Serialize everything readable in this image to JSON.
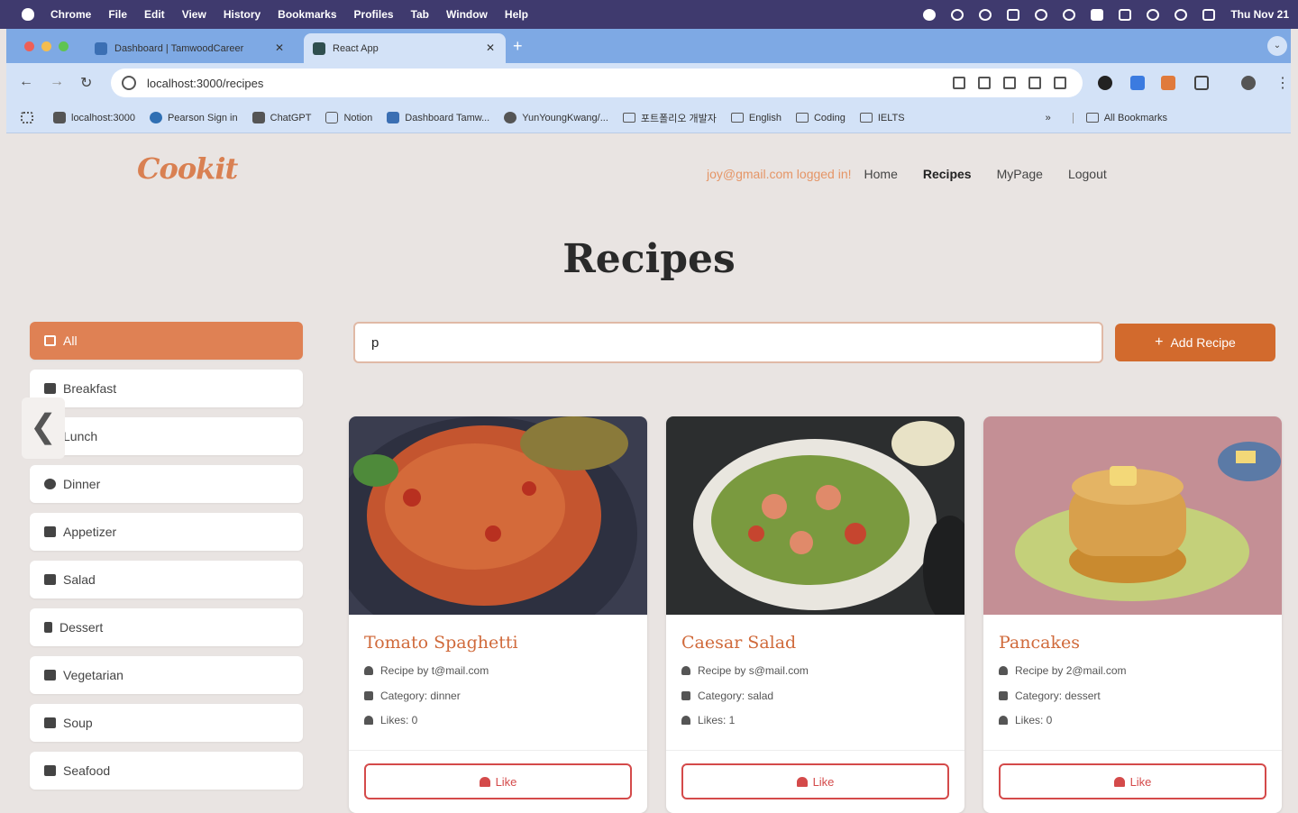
{
  "menubar": {
    "app": "Chrome",
    "items": [
      "File",
      "Edit",
      "View",
      "History",
      "Bookmarks",
      "Profiles",
      "Tab",
      "Window",
      "Help"
    ],
    "clock": "Thu Nov 21"
  },
  "tabs": [
    {
      "title": "Dashboard | TamwoodCareer",
      "active": false
    },
    {
      "title": "React App",
      "active": true
    }
  ],
  "toolbar": {
    "url": "localhost:3000/recipes"
  },
  "bookmarks": [
    {
      "label": "localhost:3000",
      "icon": "page-icon"
    },
    {
      "label": "Pearson Sign in",
      "icon": "page-icon"
    },
    {
      "label": "ChatGPT",
      "icon": "page-icon"
    },
    {
      "label": "Notion",
      "icon": "page-icon"
    },
    {
      "label": "Dashboard  Tamw...",
      "icon": "page-icon"
    },
    {
      "label": "YunYoungKwang/...",
      "icon": "github-icon"
    },
    {
      "label": "포트폴리오 개발자",
      "icon": "folder-icon"
    },
    {
      "label": "English",
      "icon": "folder-icon"
    },
    {
      "label": "Coding",
      "icon": "folder-icon"
    },
    {
      "label": "IELTS",
      "icon": "folder-icon"
    }
  ],
  "bookmarks_all": "All Bookmarks",
  "header": {
    "logo": "Cookit",
    "user_status": "joy@gmail.com logged in!",
    "nav": [
      {
        "label": "Home",
        "active": false
      },
      {
        "label": "Recipes",
        "active": true
      },
      {
        "label": "MyPage",
        "active": false
      },
      {
        "label": "Logout",
        "active": false
      }
    ]
  },
  "page_title": "Recipes",
  "categories": [
    {
      "label": "All",
      "active": true,
      "icon": "grid-icon"
    },
    {
      "label": "Breakfast",
      "active": false,
      "icon": "coffee-icon"
    },
    {
      "label": "Lunch",
      "active": false,
      "icon": "sun-icon"
    },
    {
      "label": "Dinner",
      "active": false,
      "icon": "moon-icon"
    },
    {
      "label": "Appetizer",
      "active": false,
      "icon": "plate-icon"
    },
    {
      "label": "Salad",
      "active": false,
      "icon": "leaf-icon"
    },
    {
      "label": "Dessert",
      "active": false,
      "icon": "ice-cream-icon"
    },
    {
      "label": "Vegetarian",
      "active": false,
      "icon": "carrot-icon"
    },
    {
      "label": "Soup",
      "active": false,
      "icon": "bowl-icon"
    },
    {
      "label": "Seafood",
      "active": false,
      "icon": "fish-icon"
    }
  ],
  "search": {
    "value": "p",
    "placeholder": ""
  },
  "add_button": "Add Recipe",
  "recipes": [
    {
      "title": "Tomato Spaghetti",
      "author": "Recipe by t@mail.com",
      "category": "Category: dinner",
      "likes": "Likes: 0",
      "like_label": "Like",
      "image_colors": [
        "#3a3d4f",
        "#c4552f",
        "#e07a3c"
      ]
    },
    {
      "title": "Caesar Salad",
      "author": "Recipe by s@mail.com",
      "category": "Category: salad",
      "likes": "Likes: 1",
      "like_label": "Like",
      "image_colors": [
        "#2c2e2f",
        "#e9e6df",
        "#7a9a3f"
      ]
    },
    {
      "title": "Pancakes",
      "author": "Recipe by 2@mail.com",
      "category": "Category: dessert",
      "likes": "Likes: 0",
      "like_label": "Like",
      "image_colors": [
        "#c48f95",
        "#d8a04c",
        "#c4d07a"
      ]
    }
  ]
}
